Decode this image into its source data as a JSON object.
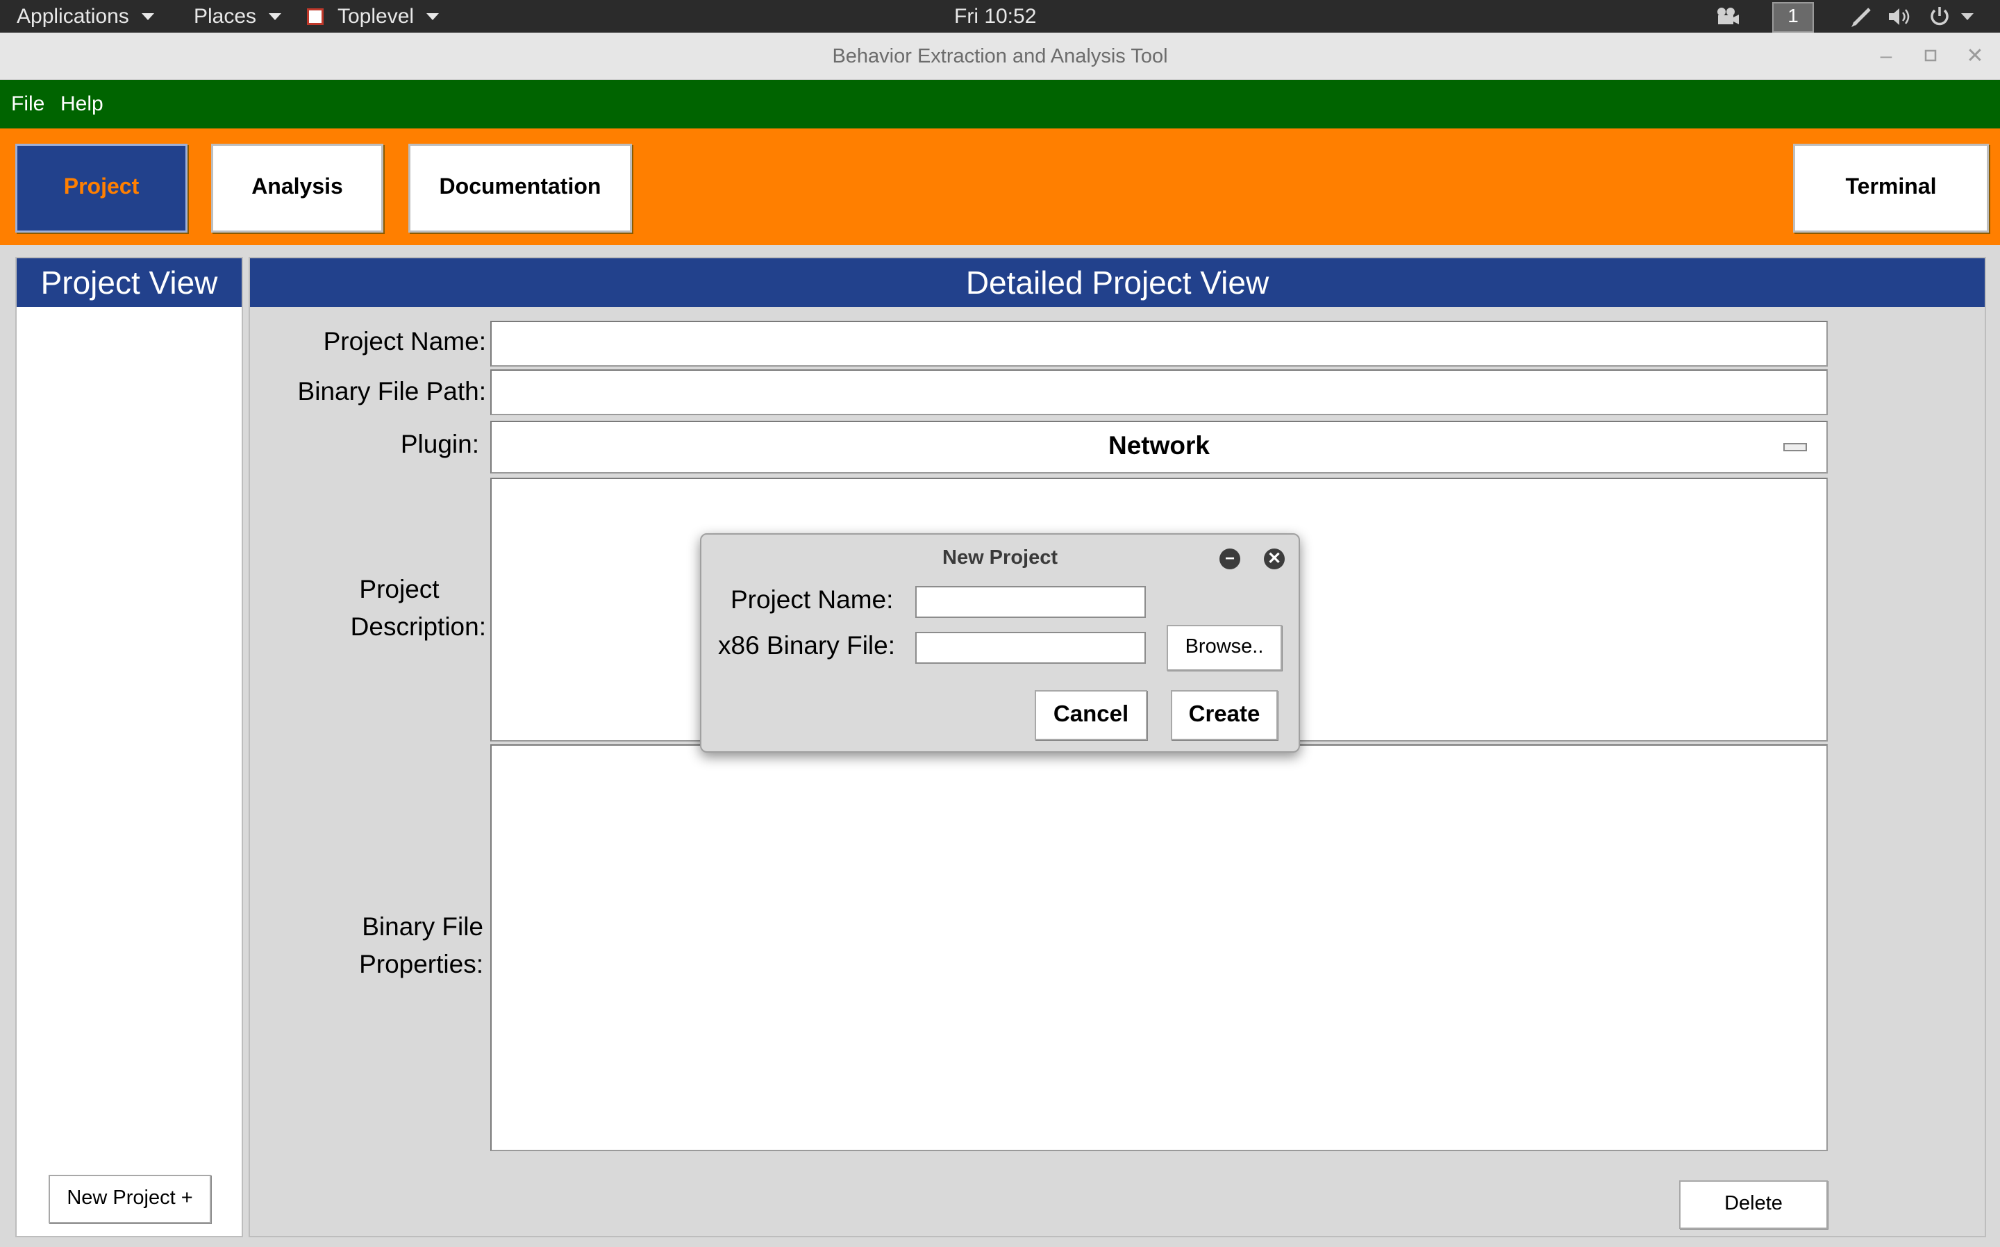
{
  "system_bar": {
    "applications": "Applications",
    "places": "Places",
    "toplevel": "Toplevel",
    "clock": "Fri 10:52",
    "workspace": "1"
  },
  "window": {
    "title": "Behavior Extraction and Analysis Tool"
  },
  "menu": {
    "file": "File",
    "help": "Help"
  },
  "toolbar": {
    "project": "Project",
    "analysis": "Analysis",
    "documentation": "Documentation",
    "terminal": "Terminal"
  },
  "project_view": {
    "header": "Project View",
    "new_project_button": "New Project +"
  },
  "detail_view": {
    "header": "Detailed Project View",
    "project_name_label": "Project Name:",
    "project_name_value": "",
    "binary_path_label": "Binary File Path:",
    "binary_path_value": "",
    "plugin_label": "Plugin:",
    "plugin_value": "Network",
    "description_label_1": "Project",
    "description_label_2": "Description:",
    "properties_label_1": "Binary File",
    "properties_label_2": "Properties:",
    "delete_button": "Delete"
  },
  "dialog": {
    "title": "New Project",
    "project_name_label": "Project Name:",
    "project_name_value": "",
    "binary_label": "x86 Binary File:",
    "binary_value": "",
    "browse_button": "Browse..",
    "cancel_button": "Cancel",
    "create_button": "Create"
  },
  "colors": {
    "menubar_green": "#006400",
    "toolbar_orange": "#ff7f00",
    "header_blue": "#22418c"
  }
}
